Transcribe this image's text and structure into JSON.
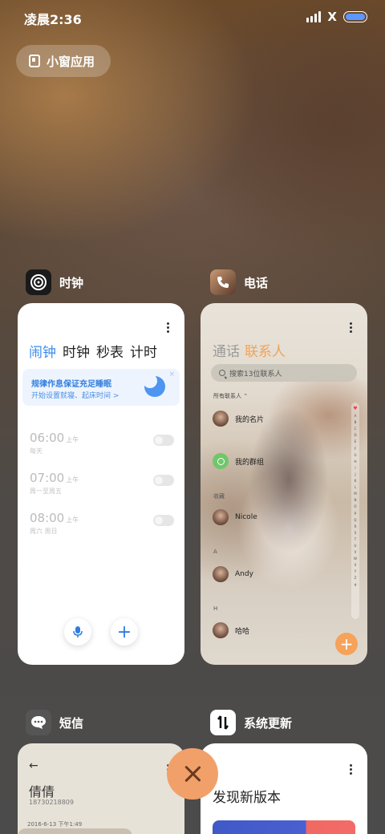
{
  "status_bar": {
    "time": "凌晨2:36",
    "wifi_symbol": "X",
    "battery_color": "#5e97ff"
  },
  "small_window": {
    "label": "小窗应用"
  },
  "clock": {
    "app_name": "时钟",
    "tabs": [
      "闹钟",
      "时钟",
      "秒表",
      "计时"
    ],
    "banner": {
      "title": "规律作息保证充足睡眠",
      "subtitle": "开始设置就寝、起床时间 >",
      "close": "×"
    },
    "alarms": [
      {
        "time": "06:00",
        "ampm": "上午",
        "repeat": "每天"
      },
      {
        "time": "07:00",
        "ampm": "上午",
        "repeat": "周一至周五"
      },
      {
        "time": "08:00",
        "ampm": "上午",
        "repeat": "周六 周日"
      }
    ],
    "add": "+"
  },
  "phone": {
    "app_name": "电话",
    "tabs": {
      "calls": "通话",
      "contacts": "联系人"
    },
    "search_placeholder": "搜索13位联系人",
    "filter": "所有联系人 ⌃",
    "contacts": {
      "my_card": "我的名片",
      "my_groups": "我的群组",
      "favorites_header": "收藏",
      "nicole": "Nicole",
      "a_header": "A",
      "andy": "Andy",
      "h_header": "H",
      "haha": "哈哈"
    },
    "index_letters": [
      "♥",
      "A",
      "B",
      "C",
      "D",
      "E",
      "F",
      "G",
      "H",
      "I",
      "J",
      "K",
      "L",
      "M",
      "N",
      "O",
      "P",
      "Q",
      "R",
      "S",
      "T",
      "U",
      "V",
      "W",
      "X",
      "Y",
      "Z",
      "#"
    ],
    "add": "+"
  },
  "sms": {
    "app_name": "短信",
    "back": "←",
    "contact_name": "倩倩",
    "number": "18730218809",
    "date": "2016-6-13 下午1:49"
  },
  "update": {
    "app_name": "系统更新",
    "title": "发现新版本"
  },
  "accent_colors": {
    "clock_blue": "#3a8ef0",
    "phone_orange": "#f0a35a",
    "close_button": "#f2a06a"
  }
}
